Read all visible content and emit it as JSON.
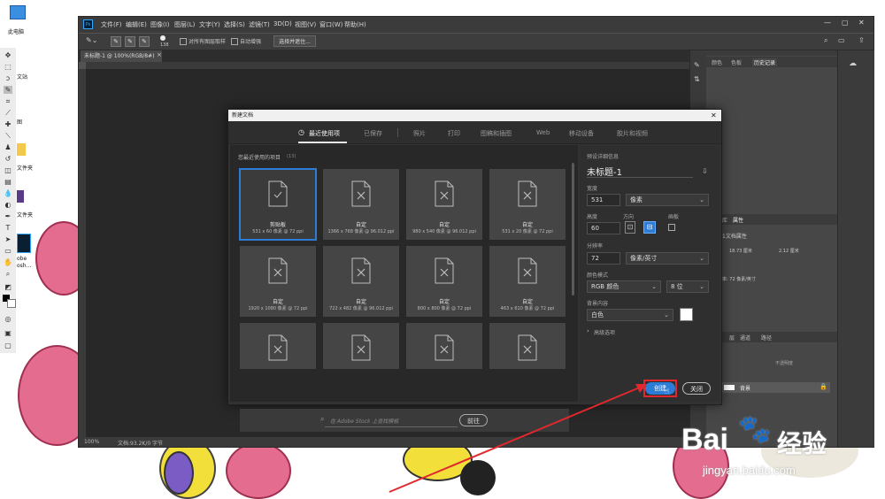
{
  "desktop": {
    "icons": [
      {
        "label": "此电脑"
      },
      {
        "label": "文站"
      },
      {
        "label": "图"
      },
      {
        "label": "文件夹"
      },
      {
        "label": "文件夹"
      },
      {
        "label": "obe"
      },
      {
        "label": "osh..."
      }
    ]
  },
  "photoshop": {
    "app_icon": "Ps",
    "menu": [
      "文件(F)",
      "编辑(E)",
      "图像(I)",
      "图层(L)",
      "文字(Y)",
      "选择(S)",
      "滤镜(T)",
      "3D(D)",
      "视图(V)",
      "窗口(W)",
      "帮助(H)"
    ],
    "options": {
      "brush_size": "138",
      "sample_all_layers": "对所有图层取样",
      "auto_enhance": "自动增强",
      "select_subject": "选择并遮住..."
    },
    "doc_tab": "未标题-1 @ 100%(RGB/8#)",
    "status": {
      "zoom": "100%",
      "doc": "文档:93.2K/0 字节"
    },
    "panels": {
      "top_tabs": [
        "颜色",
        "色板",
        "历史记录"
      ],
      "props_tabs": [
        "库",
        "属性"
      ],
      "props_title": "1文档属性",
      "props_width": "18.73 厘米",
      "props_height": "2.12 厘米",
      "props_resolution": "率: 72 像素/英寸",
      "layers_tabs": [
        "层",
        "通道",
        "路径"
      ],
      "layers_opacity": "不透明度",
      "layer_name": "背景"
    }
  },
  "dialog": {
    "title": "新建文档",
    "tabs": [
      "最近使用项",
      "已保存",
      "照片",
      "打印",
      "图稿和插图",
      "Web",
      "移动设备",
      "胶片和视频"
    ],
    "recent_label": "您最近使用的项目",
    "recent_count": "(13)",
    "items": [
      {
        "name": "剪贴板",
        "size": "531 x 60 像素 @ 72 ppi"
      },
      {
        "name": "自定",
        "size": "1366 x 768 像素 @ 96.012 ppi"
      },
      {
        "name": "自定",
        "size": "980 x 540 像素 @ 96.012 ppi"
      },
      {
        "name": "自定",
        "size": "531 x 20 像素 @ 72 ppi"
      },
      {
        "name": "自定",
        "size": "1920 x 1080 像素 @ 72 ppi"
      },
      {
        "name": "自定",
        "size": "722 x 482 像素 @ 96.012 ppi"
      },
      {
        "name": "自定",
        "size": "800 x 800 像素 @ 72 ppi"
      },
      {
        "name": "自定",
        "size": "463 x 610 像素 @ 72 ppi"
      },
      {
        "name": "",
        "size": ""
      },
      {
        "name": "",
        "size": ""
      },
      {
        "name": "",
        "size": ""
      },
      {
        "name": "",
        "size": ""
      }
    ],
    "search_placeholder": "在 Adobe Stock 上查找模板",
    "search_go": "前往",
    "preset": {
      "header": "预设详细信息",
      "name": "未标题-1",
      "width_label": "宽度",
      "width_value": "531",
      "width_unit": "像素",
      "height_label": "高度",
      "height_value": "60",
      "orientation_label": "方向",
      "artboard_label": "画板",
      "resolution_label": "分辨率",
      "resolution_value": "72",
      "resolution_unit": "像素/英寸",
      "color_mode_label": "颜色模式",
      "color_mode": "RGB 颜色",
      "bit_depth": "8 位",
      "bg_label": "背景内容",
      "bg_value": "白色",
      "advanced": "高级选项"
    },
    "create_button": "创建",
    "close_button": "关闭"
  },
  "watermark": {
    "brand": "Bai",
    "brand2": "经验",
    "url": "jingyan.baidu.com"
  },
  "colors": {
    "accent": "#2d7cd6",
    "highlight_box": "#e0282e",
    "arrow": "#e0282e"
  }
}
